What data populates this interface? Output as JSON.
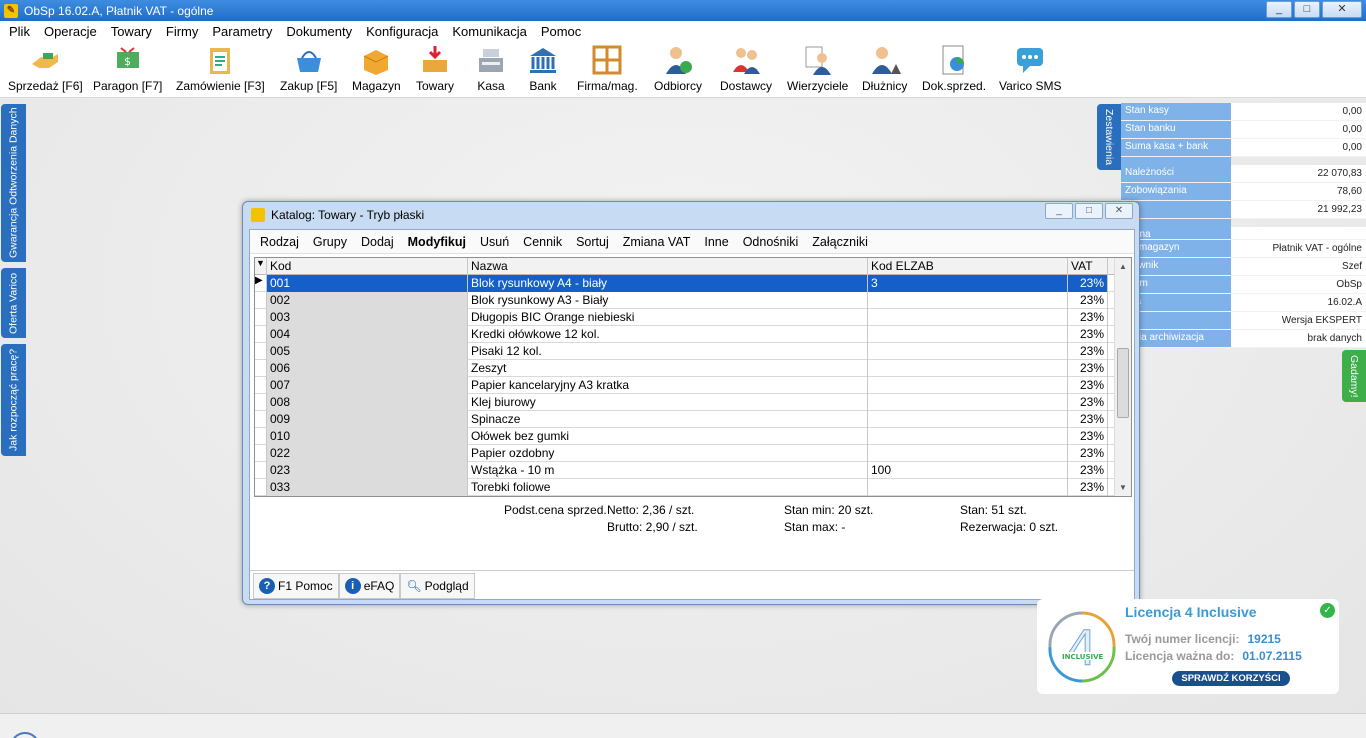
{
  "app": {
    "title": "ObSp 16.02.A, Płatnik VAT - ogólne",
    "window_buttons": [
      "_",
      "□",
      "✕"
    ]
  },
  "menu": [
    "Plik",
    "Operacje",
    "Towary",
    "Firmy",
    "Parametry",
    "Dokumenty",
    "Konfiguracja",
    "Komunikacja",
    "Pomoc"
  ],
  "toolbar": [
    {
      "label": "Sprzedaż [F6]",
      "icon": "handshake-icon"
    },
    {
      "label": "Paragon [F7]",
      "icon": "receipt-icon"
    },
    {
      "label": "Zamówienie [F3]",
      "icon": "clipboard-icon"
    },
    {
      "label": "Zakup [F5]",
      "icon": "basket-icon"
    },
    {
      "label": "Magazyn",
      "icon": "box-icon"
    },
    {
      "label": "Towary",
      "icon": "goods-icon"
    },
    {
      "label": "Kasa",
      "icon": "cash-register-icon"
    },
    {
      "label": "Bank",
      "icon": "bank-icon"
    },
    {
      "label": "Firma/mag.",
      "icon": "shelves-icon"
    },
    {
      "label": "Odbiorcy",
      "icon": "customer-icon"
    },
    {
      "label": "Dostawcy",
      "icon": "suppliers-icon"
    },
    {
      "label": "Wierzyciele",
      "icon": "creditor-icon"
    },
    {
      "label": "Dłużnicy",
      "icon": "debtor-icon"
    },
    {
      "label": "Dok.sprzed.",
      "icon": "sales-doc-icon"
    },
    {
      "label": "Varico SMS",
      "icon": "sms-icon"
    }
  ],
  "left_tabs": [
    "Gwarancja Odtworzenia Danych",
    "Oferta Varico",
    "Jak rozpocząć pracę?"
  ],
  "right_tabs": [
    "Zestawienia",
    "Gadamy!"
  ],
  "info_panel": {
    "group1": [
      {
        "k": "Stan kasy",
        "v": "0,00"
      },
      {
        "k": "Stan banku",
        "v": "0,00"
      },
      {
        "k": "Suma kasa + bank",
        "v": "0,00"
      }
    ],
    "group2": [
      {
        "k": "Należności",
        "v": "22 070,83"
      },
      {
        "k": "Zobowiązania",
        "v": "78,60"
      },
      {
        "k": "lo",
        "v": "21 992,23"
      }
    ],
    "group3": [
      {
        "k": "brana",
        "v": ""
      },
      {
        "k": "a / magazyn",
        "v": "Płatnik VAT - ogólne"
      },
      {
        "k": "tkownik",
        "v": "Szef"
      },
      {
        "k": "gram",
        "v": "ObSp"
      },
      {
        "k": "rsja",
        "v": "16.02.A"
      },
      {
        "k": "zaj",
        "v": "Wersja EKSPERT"
      },
      {
        "k": "atnia archiwizacja",
        "v": "brak danych"
      }
    ]
  },
  "catalog": {
    "title": "Katalog: Towary - Tryb płaski",
    "menu": [
      "Rodzaj",
      "Grupy",
      "Dodaj",
      "Modyfikuj",
      "Usuń",
      "Cennik",
      "Sortuj",
      "Zmiana VAT",
      "Inne",
      "Odnośniki",
      "Załączniki"
    ],
    "columns": [
      "Kod",
      "Nazwa",
      "Kod ELZAB",
      "VAT"
    ],
    "rows": [
      {
        "kod": "001",
        "nazwa": "Blok rysunkowy A4 - biały",
        "elzab": "3",
        "vat": "23%",
        "selected": true
      },
      {
        "kod": "002",
        "nazwa": "Blok rysunkowy A3 - Biały",
        "elzab": "",
        "vat": "23%"
      },
      {
        "kod": "003",
        "nazwa": "Długopis BIC Orange niebieski",
        "elzab": "",
        "vat": "23%"
      },
      {
        "kod": "004",
        "nazwa": "Kredki ołówkowe 12 kol.",
        "elzab": "",
        "vat": "23%"
      },
      {
        "kod": "005",
        "nazwa": "Pisaki 12 kol.",
        "elzab": "",
        "vat": "23%"
      },
      {
        "kod": "006",
        "nazwa": "Zeszyt",
        "elzab": "",
        "vat": "23%"
      },
      {
        "kod": "007",
        "nazwa": "Papier kancelaryjny A3 kratka",
        "elzab": "",
        "vat": "23%"
      },
      {
        "kod": "008",
        "nazwa": "Klej biurowy",
        "elzab": "",
        "vat": "23%"
      },
      {
        "kod": "009",
        "nazwa": "Spinacze",
        "elzab": "",
        "vat": "23%"
      },
      {
        "kod": "010",
        "nazwa": "Ołówek bez gumki",
        "elzab": "",
        "vat": "23%"
      },
      {
        "kod": "022",
        "nazwa": "Papier ozdobny",
        "elzab": "",
        "vat": "23%"
      },
      {
        "kod": "023",
        "nazwa": "Wstążka - 10 m",
        "elzab": "100",
        "vat": "23%"
      },
      {
        "kod": "033",
        "nazwa": "Torebki foliowe",
        "elzab": "",
        "vat": "23%"
      }
    ],
    "details": {
      "base": "Podst.cena sprzed.",
      "netto": "Netto: 2,36 / szt.",
      "brutto": "Brutto: 2,90 / szt.",
      "stan_min": "Stan min: 20 szt.",
      "stan_max": "Stan max: -",
      "stan": "Stan: 51 szt.",
      "rezerwacja": "Rezerwacja: 0 szt."
    },
    "footer": {
      "help": "F1 Pomoc",
      "efaq": "eFAQ",
      "preview": "Podgląd"
    }
  },
  "license": {
    "title": "Licencja 4 Inclusive",
    "number_label": "Twój numer licencji:",
    "number": "19215",
    "valid_label": "Licencja ważna do:",
    "valid": "01.07.2115",
    "button": "SPRAWDŹ KORZYŚCI",
    "logo_text": "INCLUSIVE"
  }
}
